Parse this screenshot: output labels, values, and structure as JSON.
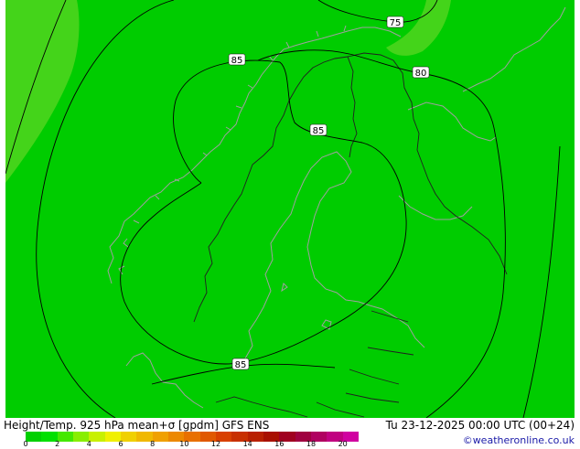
{
  "map": {
    "colors": {
      "main_fill": "#00cc00",
      "light_fill": "#44d41a",
      "coast": "#a0a0a0",
      "border": "#202020",
      "contour": "#000000"
    },
    "contour_labels": [
      "75",
      "80",
      "85",
      "85",
      "85"
    ]
  },
  "caption": {
    "left": "Height/Temp. 925 hPa mean+σ [gpdm] GFS ENS",
    "right": "Tu 23-12-2025 00:00 UTC (00+24)"
  },
  "legend": {
    "colors": [
      "#00d000",
      "#00e000",
      "#44e800",
      "#88ee00",
      "#c8f000",
      "#f0f000",
      "#f0d000",
      "#f0b800",
      "#f0a000",
      "#ec8800",
      "#e87000",
      "#e05800",
      "#d84000",
      "#c83000",
      "#b82000",
      "#a81000",
      "#a00020",
      "#a00040",
      "#b00060",
      "#c00080",
      "#d000a0"
    ],
    "ticks": [
      {
        "label": "0",
        "value": 0
      },
      {
        "label": "2",
        "value": 2
      },
      {
        "label": "4",
        "value": 4
      },
      {
        "label": "6",
        "value": 6
      },
      {
        "label": "8",
        "value": 8
      },
      {
        "label": "10",
        "value": 10
      },
      {
        "label": "12",
        "value": 12
      },
      {
        "label": "14",
        "value": 14
      },
      {
        "label": "16",
        "value": 16
      },
      {
        "label": "18",
        "value": 18
      },
      {
        "label": "20",
        "value": 20
      }
    ],
    "max": 21
  },
  "credit": "©weatheronline.co.uk"
}
